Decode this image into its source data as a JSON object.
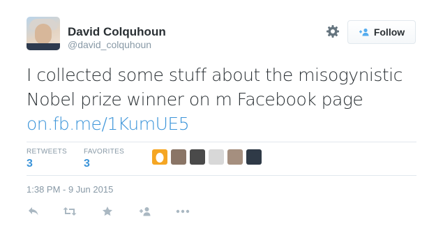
{
  "tweet": {
    "author": {
      "name": "David Colquhoun",
      "handle": "@david_colquhoun"
    },
    "follow_label": "Follow",
    "text": "I collected some stuff about the misogynistic Nobel prize winner on m Facebook page",
    "link_text": "on.fb.me/1KumUE5",
    "stats": {
      "retweets_label": "RETWEETS",
      "retweets_count": "3",
      "favorites_label": "FAVORITES",
      "favorites_count": "3"
    },
    "timestamp": "1:38 PM - 9 Jun 2015",
    "favoriters": [
      {
        "color": "#f5a623"
      },
      {
        "color": "#8a7566"
      },
      {
        "color": "#4a4a4a"
      },
      {
        "color": "#d8d8d8"
      },
      {
        "color": "#a58f7f"
      },
      {
        "color": "#2f3a47"
      }
    ]
  }
}
